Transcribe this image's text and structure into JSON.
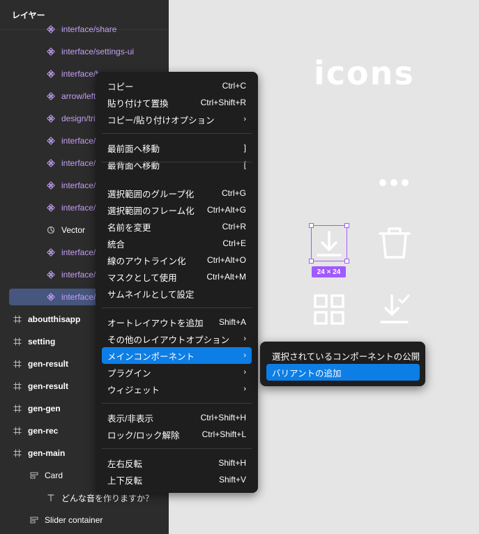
{
  "layers_panel": {
    "header": "レイヤー",
    "rows": [
      {
        "label": "interface/share",
        "kind": "component"
      },
      {
        "label": "interface/settings-ui",
        "kind": "component"
      },
      {
        "label": "interface/bo",
        "kind": "component"
      },
      {
        "label": "arrow/left",
        "kind": "component"
      },
      {
        "label": "design/tri",
        "kind": "component"
      },
      {
        "label": "interface/",
        "kind": "component"
      },
      {
        "label": "interface/",
        "kind": "component"
      },
      {
        "label": "interface/",
        "kind": "component"
      },
      {
        "label": "interface/",
        "kind": "component"
      },
      {
        "label": "Vector",
        "kind": "vector"
      },
      {
        "label": "interface/",
        "kind": "component"
      },
      {
        "label": "interface/",
        "kind": "component"
      },
      {
        "label": "interface/",
        "kind": "component",
        "selected": true
      },
      {
        "label": "aboutthisapp",
        "kind": "frame"
      },
      {
        "label": "setting",
        "kind": "frame"
      },
      {
        "label": "gen-result",
        "kind": "frame"
      },
      {
        "label": "gen-result",
        "kind": "frame"
      },
      {
        "label": "gen-gen",
        "kind": "frame"
      },
      {
        "label": "gen-rec",
        "kind": "frame"
      },
      {
        "label": "gen-main",
        "kind": "frame"
      },
      {
        "label": "Card",
        "kind": "autolayout"
      },
      {
        "label": "どんな音を作りますか？",
        "kind": "text"
      },
      {
        "label": "Slider container",
        "kind": "autolayout"
      }
    ]
  },
  "canvas": {
    "title": "icons",
    "size_badge": "24 × 24"
  },
  "context_menu": {
    "groups": [
      [
        {
          "label": "コピー",
          "shortcut": "Ctrl+C"
        },
        {
          "label": "貼り付けて置換",
          "shortcut": "Ctrl+Shift+R"
        },
        {
          "label": "コピー/貼り付けオプション",
          "submenu": true
        }
      ],
      [
        {
          "label": "最前面へ移動",
          "shortcut": "]"
        },
        {
          "label": "最背面へ移動",
          "shortcut": "["
        }
      ],
      [
        {
          "label": "選択範囲のグループ化",
          "shortcut": "Ctrl+G"
        },
        {
          "label": "選択範囲のフレーム化",
          "shortcut": "Ctrl+Alt+G"
        },
        {
          "label": "名前を変更",
          "shortcut": "Ctrl+R"
        },
        {
          "label": "統合",
          "shortcut": "Ctrl+E"
        },
        {
          "label": "線のアウトライン化",
          "shortcut": "Ctrl+Alt+O"
        },
        {
          "label": "マスクとして使用",
          "shortcut": "Ctrl+Alt+M"
        },
        {
          "label": "サムネイルとして設定",
          "shortcut": ""
        }
      ],
      [
        {
          "label": "オートレイアウトを追加",
          "shortcut": "Shift+A"
        },
        {
          "label": "その他のレイアウトオプション",
          "submenu": true
        },
        {
          "label": "メインコンポーネント",
          "submenu": true,
          "active": true
        },
        {
          "label": "プラグイン",
          "submenu": true
        },
        {
          "label": "ウィジェット",
          "submenu": true
        }
      ],
      [
        {
          "label": "表示/非表示",
          "shortcut": "Ctrl+Shift+H"
        },
        {
          "label": "ロック/ロック解除",
          "shortcut": "Ctrl+Shift+L"
        }
      ],
      [
        {
          "label": "左右反転",
          "shortcut": "Shift+H"
        },
        {
          "label": "上下反転",
          "shortcut": "Shift+V"
        }
      ]
    ]
  },
  "submenu": {
    "items": [
      {
        "label": "選択されているコンポーネントの公開"
      },
      {
        "label": "バリアントの追加",
        "active": true
      }
    ]
  },
  "colors": {
    "accent": "#0d7ee6",
    "component_text": "#c4a0f4",
    "selection": "#a259ff"
  }
}
